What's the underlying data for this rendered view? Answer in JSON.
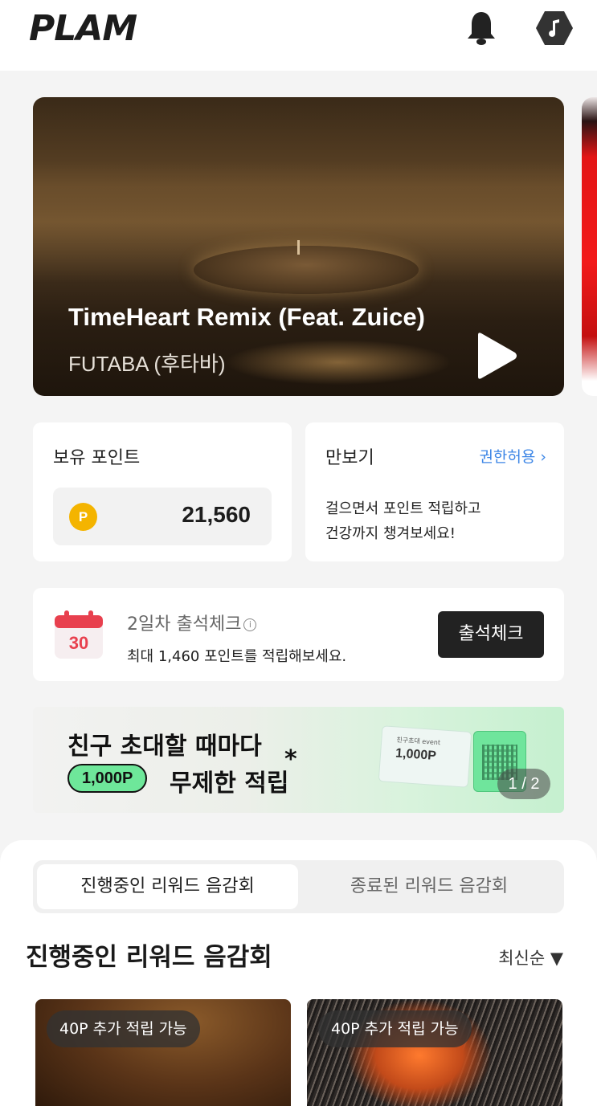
{
  "header": {
    "logo": "PLAM"
  },
  "hero": {
    "title": "TimeHeart Remix (Feat. Zuice)",
    "artist": "FUTABA (후타바)"
  },
  "points": {
    "label": "보유 포인트",
    "coin": "P",
    "value": "21,560"
  },
  "steps": {
    "title": "만보기",
    "permission": "권한허용 ›",
    "desc_line1": "걸으면서 포인트 적립하고",
    "desc_line2": "건강까지 챙겨보세요!"
  },
  "attendance": {
    "calendar_day": "30",
    "title": "2일차 출석체크",
    "info": "i",
    "subtitle": "최대 1,460 포인트를 적립해보세요.",
    "button": "출석체크"
  },
  "banner": {
    "line1": "친구 초대할 때마다",
    "pill": "1,000P",
    "line2": "무제한 적립",
    "star": "*",
    "ticket_text": "친구초대 event",
    "ticket_value": "1,000P",
    "pager": "1 / 2"
  },
  "tabs": {
    "active": "진행중인 리워드 음감회",
    "inactive": "종료된 리워드 음감회"
  },
  "section": {
    "title": "진행중인 리워드 음감회",
    "sort": "최신순 ▼"
  },
  "cards": [
    {
      "badge": "40P 추가 적립 가능"
    },
    {
      "badge": "40P 추가 적립 가능"
    }
  ],
  "colors": {
    "accent_blue": "#3d86e6",
    "coin": "#f4b400",
    "calendar_red": "#e8404e",
    "pill_green": "#6ee79a"
  }
}
